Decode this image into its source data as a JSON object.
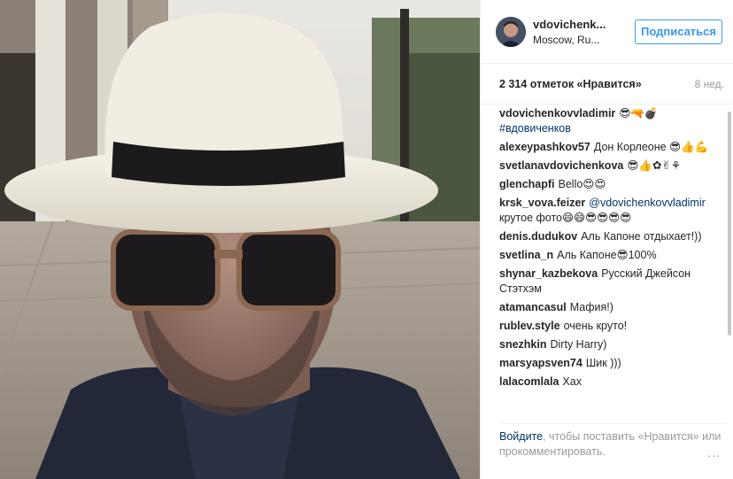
{
  "header": {
    "username": "vdovichenk...",
    "location": "Moscow, Ru...",
    "follow_label": "Подписаться"
  },
  "stats": {
    "likes": "2 314 отметок «Нравится»",
    "age": "8 нед."
  },
  "comments": [
    {
      "author": "vdovichenkovvladimir",
      "text": "😎🔫💣",
      "tag": "#вдовиченков"
    },
    {
      "author": "alexeypashkov57",
      "text": "Дон Корлеоне 😎👍💪"
    },
    {
      "author": "svetlanavdovichenkova",
      "text": "😎👍✿✌⚘"
    },
    {
      "author": "glenchapfi",
      "text": "Bello😍😍"
    },
    {
      "author": "krsk_vova.feizer",
      "mention": "@vdovichenkovvladimir",
      "text": "крутое фото😄😄😎😎😎😎"
    },
    {
      "author": "denis.dudukov",
      "text": "Аль Капоне отдыхает!))"
    },
    {
      "author": "svetlina_n",
      "text": "Аль Капоне😎100%"
    },
    {
      "author": "shynar_kazbekova",
      "text": "Русский Джейсон Стэтхэм"
    },
    {
      "author": "atamancasul",
      "text": "Мафия!)"
    },
    {
      "author": "rublev.style",
      "text": "очень круто!"
    },
    {
      "author": "snezhkin",
      "text": "Dirty Harry)"
    },
    {
      "author": "marsyapsven74",
      "text": "Шик )))"
    },
    {
      "author": "lalacomlala",
      "text": "Хах"
    }
  ],
  "footer": {
    "login_link": "Войдите",
    "text": ", чтобы поставить «Нравится» или прокомментировать.",
    "more_icon": "..."
  },
  "colors": {
    "accent": "#3897f0",
    "link": "#003569",
    "muted": "#999999"
  }
}
